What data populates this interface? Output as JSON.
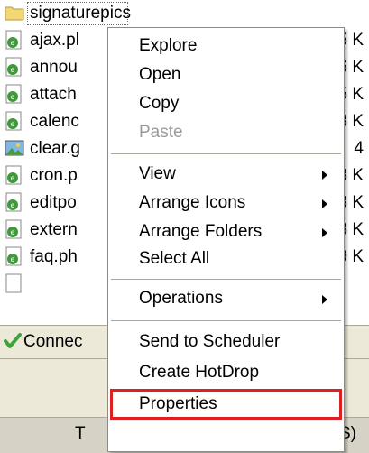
{
  "files": [
    {
      "name": "signaturepics",
      "size": "",
      "icon": "folder-icon",
      "selected": true
    },
    {
      "name": "ajax.pl",
      "size": "5 K",
      "icon": "php-file-icon"
    },
    {
      "name": "annou",
      "size": "6 K",
      "icon": "php-file-icon"
    },
    {
      "name": "attach",
      "size": "5 K",
      "icon": "php-file-icon"
    },
    {
      "name": "calenc",
      "size": "3 K",
      "icon": "php-file-icon"
    },
    {
      "name": "clear.g",
      "size": "4",
      "icon": "image-file-icon"
    },
    {
      "name": "cron.p",
      "size": "3 K",
      "icon": "php-file-icon"
    },
    {
      "name": "editpo",
      "size": "3 K",
      "icon": "php-file-icon"
    },
    {
      "name": "extern",
      "size": "8 K",
      "icon": "php-file-icon"
    },
    {
      "name": "faq.ph",
      "size": "9 K",
      "icon": "php-file-icon"
    }
  ],
  "status": {
    "label": "Connec",
    "icon": "checkmark-icon"
  },
  "bottom_bar": {
    "left": "T",
    "right": "S)"
  },
  "context_menu": {
    "items": [
      {
        "id": "explore",
        "label": "Explore"
      },
      {
        "id": "open",
        "label": "Open"
      },
      {
        "id": "copy",
        "label": "Copy"
      },
      {
        "id": "paste",
        "label": "Paste",
        "disabled": true
      },
      {
        "id": "view",
        "label": "View",
        "submenu": true
      },
      {
        "id": "arrange-icons",
        "label": "Arrange Icons",
        "submenu": true
      },
      {
        "id": "arrange-folders",
        "label": "Arrange Folders",
        "submenu": true
      },
      {
        "id": "select-all",
        "label": "Select All"
      },
      {
        "id": "operations",
        "label": "Operations",
        "submenu": true
      },
      {
        "id": "send-to-scheduler",
        "label": "Send to Scheduler"
      },
      {
        "id": "create-hotdrop",
        "label": "Create HotDrop"
      },
      {
        "id": "properties",
        "label": "Properties",
        "highlighted": true
      }
    ]
  },
  "colors": {
    "highlight_border": "#e02020",
    "status_check": "#3aa43a",
    "folder": "#f3d775"
  }
}
